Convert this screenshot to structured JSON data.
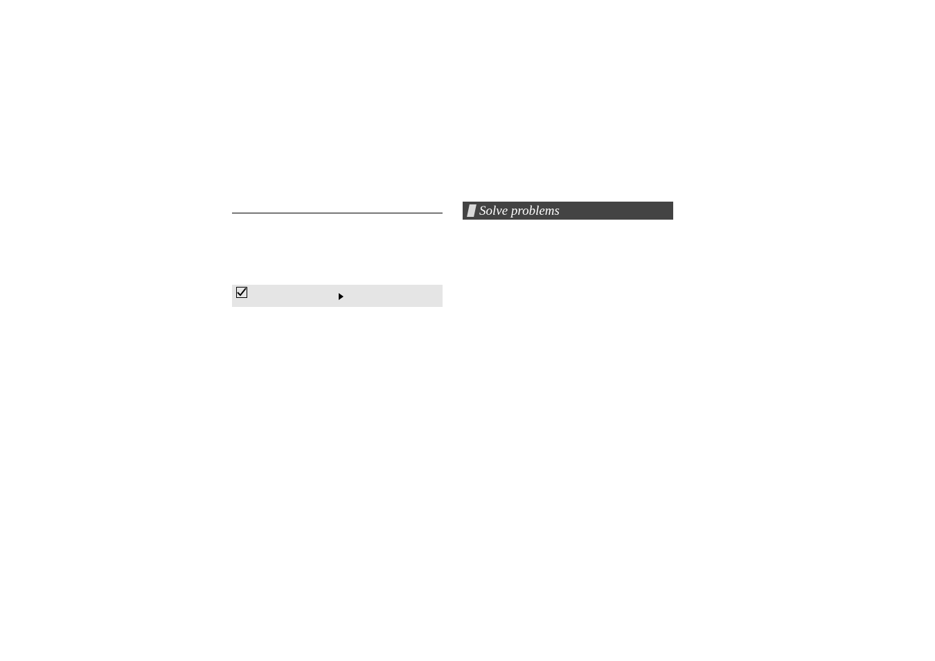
{
  "banner": {
    "title": "Solve problems"
  }
}
